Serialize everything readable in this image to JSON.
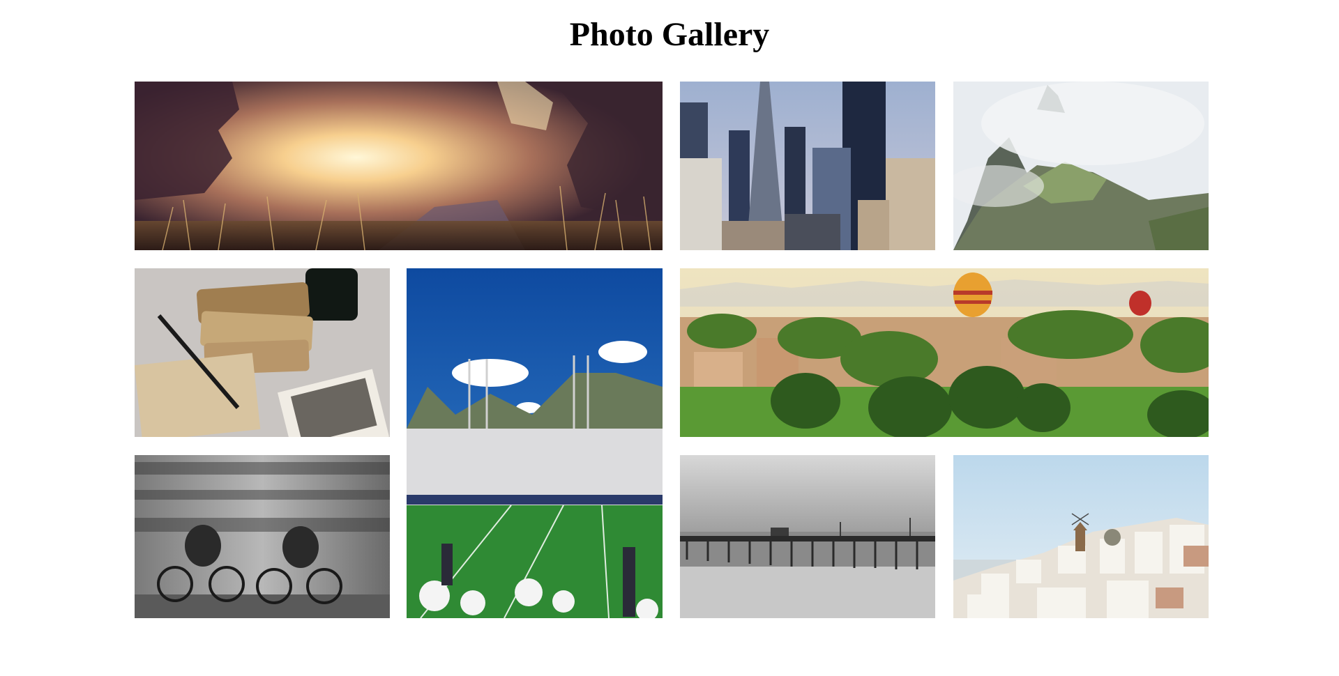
{
  "page": {
    "title": "Photo Gallery"
  },
  "gallery": {
    "photos": [
      {
        "id": "sunset-field"
      },
      {
        "id": "city-skyline"
      },
      {
        "id": "misty-mountain-ruins"
      },
      {
        "id": "letters-and-pen"
      },
      {
        "id": "football-stadium"
      },
      {
        "id": "hot-air-balloons-palms"
      },
      {
        "id": "blurred-cyclists"
      },
      {
        "id": "ocean-pier"
      },
      {
        "id": "white-village"
      }
    ]
  }
}
